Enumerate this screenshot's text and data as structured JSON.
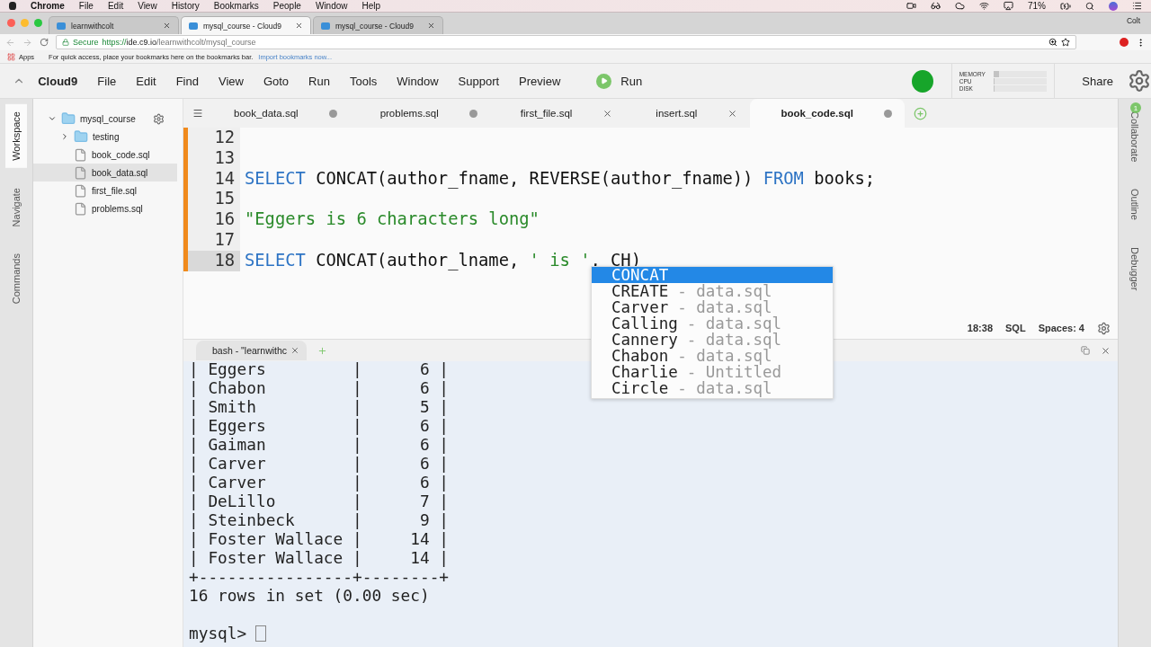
{
  "mac_menu": {
    "app": "Chrome",
    "items": [
      "File",
      "Edit",
      "View",
      "History",
      "Bookmarks",
      "People",
      "Window",
      "Help"
    ],
    "battery": "71%"
  },
  "browser": {
    "tabs": [
      {
        "title": "learnwithcolt",
        "selected": false
      },
      {
        "title": "mysql_course - Cloud9",
        "selected": true
      },
      {
        "title": "mysql_course - Cloud9",
        "selected": false
      }
    ],
    "profile": "Colt",
    "secure": "Secure",
    "url_scheme": "https://",
    "url_host": "ide.c9.io",
    "url_path": "/learnwithcolt/mysql_course",
    "bookmarks": {
      "apps": "Apps",
      "hint": "For quick access, place your bookmarks here on the bookmarks bar.",
      "import_link": "Import bookmarks now..."
    }
  },
  "ide": {
    "brand": "Cloud9",
    "menu": [
      "File",
      "Edit",
      "Find",
      "View",
      "Goto",
      "Run",
      "Tools",
      "Window",
      "Support"
    ],
    "preview": "Preview",
    "run": "Run",
    "meters": [
      {
        "label": "MEMORY",
        "level": 0.1
      },
      {
        "label": "CPU",
        "level": 0.02
      },
      {
        "label": "DISK",
        "level": 0.02
      }
    ],
    "share": "Share"
  },
  "left_panels": [
    {
      "label": "Workspace",
      "selected": true
    },
    {
      "label": "Navigate",
      "selected": false
    },
    {
      "label": "Commands",
      "selected": false
    }
  ],
  "right_panels": [
    {
      "label": "Collaborate",
      "badge": "1"
    },
    {
      "label": "Outline"
    },
    {
      "label": "Debugger"
    }
  ],
  "tree": [
    {
      "name": "mysql_course",
      "kind": "folder",
      "expanded": true,
      "selected": false,
      "children": [
        {
          "name": "testing",
          "kind": "folder",
          "expanded": false,
          "selected": false
        },
        {
          "name": "book_code.sql",
          "kind": "file",
          "selected": false
        },
        {
          "name": "book_data.sql",
          "kind": "file",
          "selected": true
        },
        {
          "name": "first_file.sql",
          "kind": "file",
          "selected": false
        },
        {
          "name": "problems.sql",
          "kind": "file",
          "selected": false
        }
      ]
    }
  ],
  "editor_tabs": [
    {
      "title": "book_data.sql",
      "modified": true,
      "selected": false
    },
    {
      "title": "problems.sql",
      "modified": true,
      "selected": false
    },
    {
      "title": "first_file.sql",
      "modified": false,
      "selected": false
    },
    {
      "title": "insert.sql",
      "modified": false,
      "selected": false
    },
    {
      "title": "book_code.sql",
      "modified": true,
      "selected": true
    }
  ],
  "code_lines": [
    {
      "number": "12",
      "current": false
    },
    {
      "number": "13",
      "current": false
    },
    {
      "number": "14",
      "current": false,
      "tokens": [
        {
          "kind": "keyword",
          "text": "SELECT"
        },
        {
          "kind": "plain",
          "text": " CONCAT(author_fname, REVERSE(author_fname)) "
        },
        {
          "kind": "keyword",
          "text": "FROM"
        },
        {
          "kind": "plain",
          "text": " books;"
        }
      ]
    },
    {
      "number": "15",
      "current": false
    },
    {
      "number": "16",
      "current": false,
      "tokens": [
        {
          "kind": "string",
          "text": "\"Eggers is 6 characters long\""
        }
      ]
    },
    {
      "number": "17",
      "current": false
    },
    {
      "number": "18",
      "current": true,
      "tokens": [
        {
          "kind": "keyword",
          "text": "SELECT"
        },
        {
          "kind": "plain",
          "text": " CONCAT(author_lname, "
        },
        {
          "kind": "string",
          "text": "' is '"
        },
        {
          "kind": "plain",
          "text": ", CH)"
        }
      ]
    }
  ],
  "autocomplete": [
    {
      "label": "CONCAT",
      "selected": true
    },
    {
      "label": "CREATE",
      "source": "- data.sql",
      "selected": false
    },
    {
      "label": "Carver",
      "source": "- data.sql",
      "selected": false
    },
    {
      "label": "Calling",
      "source": "- data.sql",
      "selected": false
    },
    {
      "label": "Cannery",
      "source": "- data.sql",
      "selected": false
    },
    {
      "label": "Chabon",
      "source": "- data.sql",
      "selected": false
    },
    {
      "label": "Charlie",
      "source": "- Untitled",
      "selected": false
    },
    {
      "label": "Circle",
      "source": "- data.sql",
      "selected": false
    }
  ],
  "status": {
    "position": "18:38",
    "mode": "SQL",
    "indent": "Spaces: 4"
  },
  "terminal": {
    "tab": "bash - \"learnwithc",
    "lines": [
      "| Eggers         |      6 |",
      "| Chabon         |      6 |",
      "| Smith          |      5 |",
      "| Eggers         |      6 |",
      "| Gaiman         |      6 |",
      "| Carver         |      6 |",
      "| Carver         |      6 |",
      "| DeLillo        |      7 |",
      "| Steinbeck      |      9 |",
      "| Foster Wallace |     14 |",
      "| Foster Wallace |     14 |",
      "+----------------+--------+",
      "16 rows in set (0.00 sec)"
    ],
    "prompt": "mysql>"
  }
}
